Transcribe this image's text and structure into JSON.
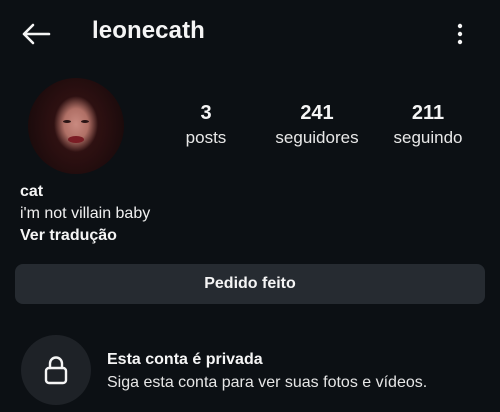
{
  "header": {
    "username": "leonecath",
    "back_icon": "arrow-left-icon",
    "more_icon": "more-vertical-icon"
  },
  "stats": [
    {
      "value": "3",
      "label": "posts"
    },
    {
      "value": "241",
      "label": "seguidores"
    },
    {
      "value": "211",
      "label": "seguindo"
    }
  ],
  "bio": {
    "name": "cat",
    "text": "i'm not villain baby",
    "translate_label": "Ver tradução"
  },
  "actions": {
    "request_label": "Pedido feito"
  },
  "private": {
    "icon": "lock-icon",
    "title": "Esta conta é privada",
    "description": "Siga esta conta para ver suas fotos e vídeos."
  },
  "colors": {
    "background": "#0c1014",
    "button_bg": "#262b31",
    "lock_circle_bg": "#1e2227",
    "text": "#f5f5f5"
  }
}
